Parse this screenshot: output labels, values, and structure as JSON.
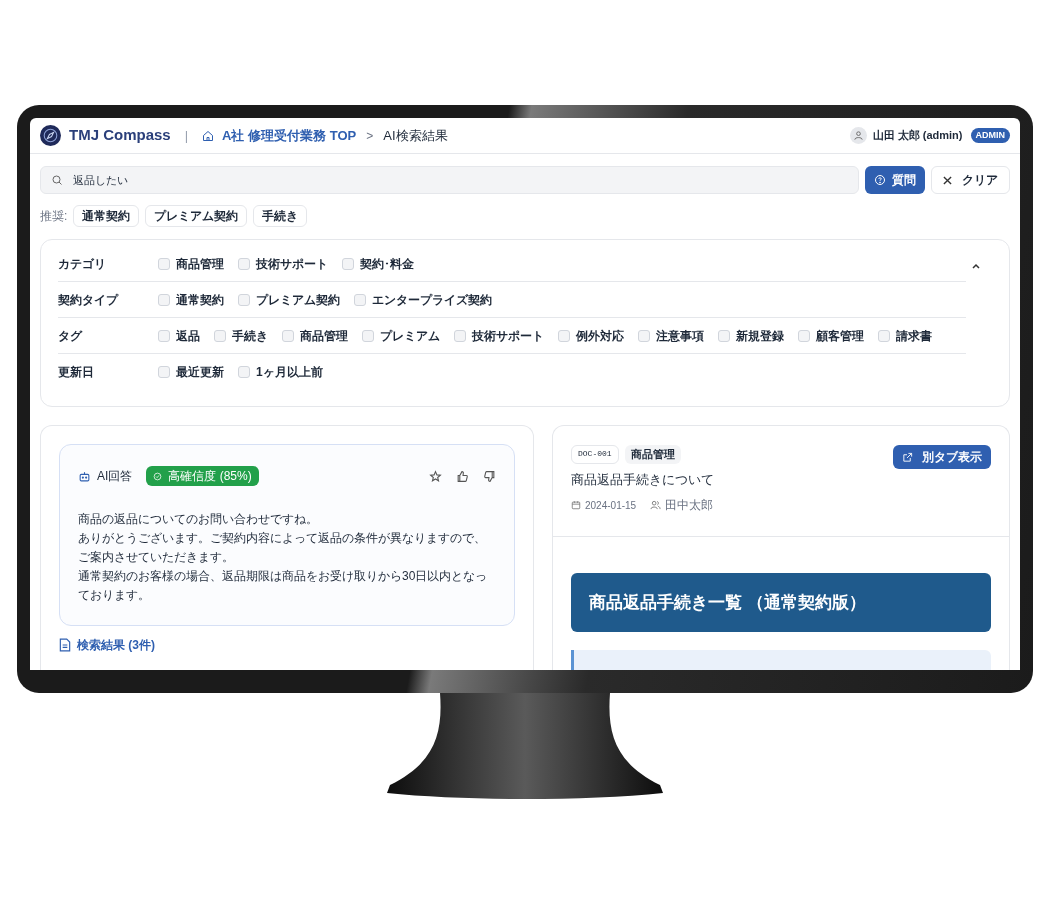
{
  "header": {
    "logo": "TMJ Compass",
    "separator": "|",
    "breadcrumb": [
      {
        "label": "A社 修理受付業務 TOP",
        "kind": "link"
      },
      {
        "label": "AI検索結果",
        "kind": "current"
      }
    ],
    "breadcrumb_separator": ">",
    "user": "山田 太郎 (admin)",
    "role_badge": "ADMIN"
  },
  "search": {
    "value": "返品したい",
    "ask_button": "質問",
    "clear_button": "クリア",
    "suggest_label": "推奨:",
    "suggestions": [
      "通常契約",
      "プレミアム契約",
      "手続き"
    ]
  },
  "filters": {
    "expanded": true,
    "groups": [
      {
        "label": "カテゴリ",
        "options": [
          {
            "label": "商品管理",
            "checked": false
          },
          {
            "label": "技術サポート",
            "checked": false
          },
          {
            "label": "契約･料金",
            "checked": false
          }
        ]
      },
      {
        "label": "契約タイプ",
        "options": [
          {
            "label": "通常契約",
            "checked": false
          },
          {
            "label": "プレミアム契約",
            "checked": false
          },
          {
            "label": "エンタープライズ契約",
            "checked": false
          }
        ]
      },
      {
        "label": "タグ",
        "options": [
          {
            "label": "返品",
            "checked": false
          },
          {
            "label": "手続き",
            "checked": false
          },
          {
            "label": "商品管理",
            "checked": false
          },
          {
            "label": "プレミアム",
            "checked": false
          },
          {
            "label": "技術サポート",
            "checked": false
          },
          {
            "label": "例外対応",
            "checked": false
          },
          {
            "label": "注意事項",
            "checked": false
          },
          {
            "label": "新規登録",
            "checked": false
          },
          {
            "label": "顧客管理",
            "checked": false
          },
          {
            "label": "請求書",
            "checked": false
          }
        ]
      },
      {
        "label": "更新日",
        "options": [
          {
            "label": "最近更新",
            "checked": false
          },
          {
            "label": "1ヶ月以上前",
            "checked": false
          }
        ]
      }
    ]
  },
  "ai_answer": {
    "title": "AI回答",
    "confidence": "高確信度 (85%)",
    "paragraphs": [
      "商品の返品についてのお問い合わせですね。",
      "ありがとうございます。ご契約内容によって返品の条件が異なりますので、ご案内させていただきます。",
      "通常契約のお客様の場合、返品期限は商品をお受け取りから30日以内となっております。"
    ]
  },
  "results_heading": "検索結果 (3件)",
  "document": {
    "id": "DOC-001",
    "category": "商品管理",
    "open_button": "別タブ表示",
    "title": "商品返品手続きについて",
    "date": "2024-01-15",
    "author": "田中太郎",
    "banner": "商品返品手続き一覧 （通常契約版）"
  }
}
